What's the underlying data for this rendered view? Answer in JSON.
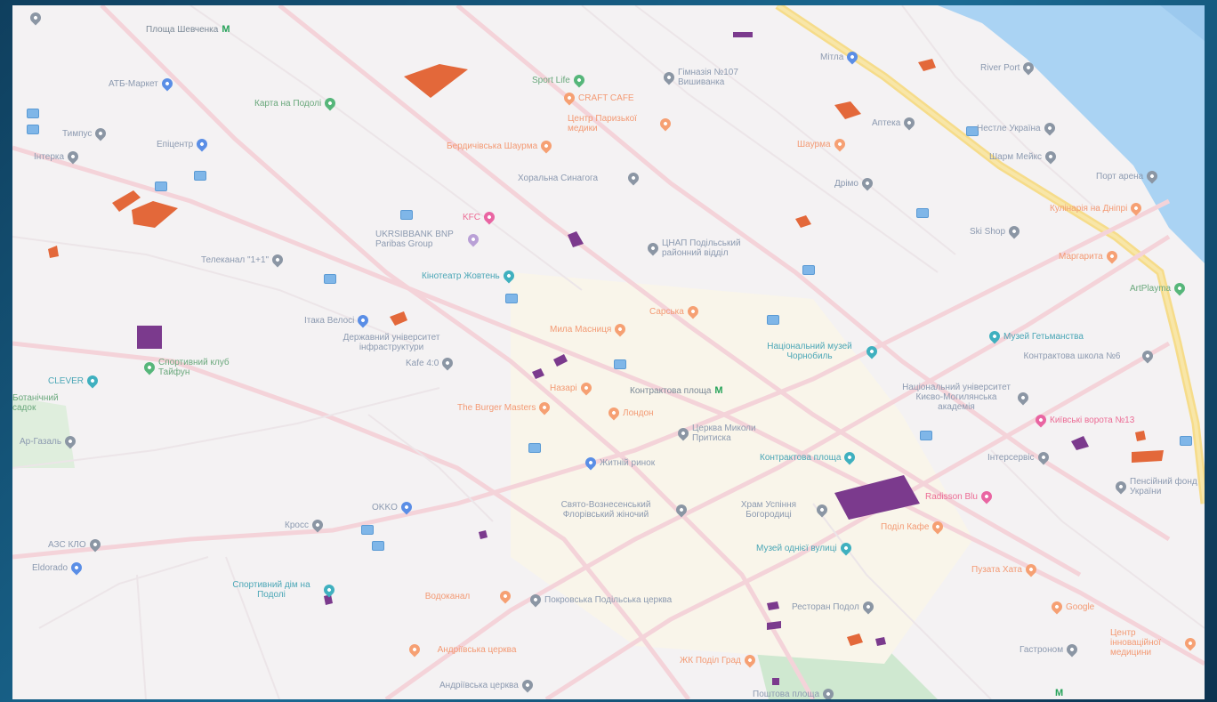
{
  "colors": {
    "water": "#aad3f3",
    "road_major": "#f6dc8a",
    "road_minor": "#f7d7dc",
    "park": "#cfe8d0",
    "building_orange": "#e3683a",
    "building_purple": "#7b3a8d",
    "pin_grey": "#8b96a4",
    "pin_blue": "#5a8ee6",
    "pin_orange": "#f6a073",
    "pin_green": "#56b67a",
    "pin_pink": "#e965a2",
    "pin_teal": "#3fb0bf"
  },
  "pois": [
    {
      "label": "",
      "icon": "grey-pin-icon",
      "kind": "shop",
      "color": "#8b96a4"
    },
    {
      "label": "Площа Шевченка",
      "icon": "metro-icon",
      "kind": "metro",
      "color": "#8b96a4"
    },
    {
      "label": "АТБ-Маркет",
      "icon": "shop-pin-icon",
      "kind": "shop",
      "color": "#5a8ee6"
    },
    {
      "label": "Карта на Подолі",
      "icon": "park-pin-icon",
      "kind": "park",
      "color": "#56b67a"
    },
    {
      "label": "Sport Life",
      "icon": "park-pin-icon",
      "kind": "park",
      "color": "#56b67a"
    },
    {
      "label": "CRAFT CAFE",
      "icon": "food-pin-icon",
      "kind": "food",
      "color": "#f6a073"
    },
    {
      "label": "Гімназія №107 Вишиванка",
      "icon": "grey-pin-icon",
      "kind": "shop",
      "color": "#8b96a4"
    },
    {
      "label": "Мітла",
      "icon": "shop-pin-icon",
      "kind": "shop",
      "color": "#5a8ee6"
    },
    {
      "label": "River Port",
      "icon": "grey-pin-icon",
      "kind": "shop",
      "color": "#8b96a4"
    },
    {
      "label": "Тимпус",
      "icon": "grey-pin-icon",
      "kind": "shop",
      "color": "#8b96a4"
    },
    {
      "label": "Епіцентр",
      "icon": "shop-pin-icon",
      "kind": "shop",
      "color": "#5a8ee6"
    },
    {
      "label": "Інтерка",
      "icon": "grey-pin-icon",
      "kind": "shop",
      "color": "#8b96a4"
    },
    {
      "label": "Центр Паризької медики",
      "icon": "food-pin-icon",
      "kind": "food",
      "color": "#f6a073"
    },
    {
      "label": "Бердичівська Шаурма",
      "icon": "food-pin-icon",
      "kind": "food",
      "color": "#f6a073"
    },
    {
      "label": "Хоральна Синагога",
      "icon": "grey-pin-icon",
      "kind": "shop",
      "color": "#8b96a4"
    },
    {
      "label": "Аптека",
      "icon": "grey-pin-icon",
      "kind": "shop",
      "color": "#8b96a4"
    },
    {
      "label": "Нестле Україна",
      "icon": "grey-pin-icon",
      "kind": "shop",
      "color": "#8b96a4"
    },
    {
      "label": "Шаурма",
      "icon": "food-pin-icon",
      "kind": "food",
      "color": "#f6a073"
    },
    {
      "label": "Шарм Мейкс",
      "icon": "grey-pin-icon",
      "kind": "shop",
      "color": "#8b96a4"
    },
    {
      "label": "Порт арена",
      "icon": "grey-pin-icon",
      "kind": "shop",
      "color": "#8b96a4"
    },
    {
      "label": "Дрімо",
      "icon": "grey-pin-icon",
      "kind": "shop",
      "color": "#8b96a4"
    },
    {
      "label": "KFC",
      "icon": "pink-pin-icon",
      "kind": "pink",
      "color": "#e965a2"
    },
    {
      "label": "UKRSIBBANK BNP Paribas Group",
      "icon": "bank-pin-icon",
      "kind": "shop",
      "color": "#b9a0d6"
    },
    {
      "label": "Телеканал \"1+1\"",
      "icon": "grey-pin-icon",
      "kind": "shop",
      "color": "#8b96a4"
    },
    {
      "label": "Кінотеатр Жовтень",
      "icon": "teal-pin-icon",
      "kind": "teal",
      "color": "#3fb0bf"
    },
    {
      "label": "ЦНАП Подільський районний відділ",
      "icon": "grey-pin-icon",
      "kind": "shop",
      "color": "#8b96a4"
    },
    {
      "label": "Кулінарія на Дніпрі",
      "icon": "food-pin-icon",
      "kind": "food",
      "color": "#f6a073"
    },
    {
      "label": "Ski Shop",
      "icon": "grey-pin-icon",
      "kind": "shop",
      "color": "#8b96a4"
    },
    {
      "label": "Маргарита",
      "icon": "food-pin-icon",
      "kind": "food",
      "color": "#f6a073"
    },
    {
      "label": "ArtPlayma",
      "icon": "park-pin-icon",
      "kind": "park",
      "color": "#56b67a"
    },
    {
      "label": "Сарська",
      "icon": "food-pin-icon",
      "kind": "food",
      "color": "#f6a073"
    },
    {
      "label": "Ітака Велосі",
      "icon": "shop-pin-icon",
      "kind": "shop",
      "color": "#5a8ee6"
    },
    {
      "label": "Державний університет інфраструктури",
      "icon": "grey-pin-icon",
      "kind": "shop",
      "color": "#8b96a4"
    },
    {
      "label": "Мила Масниця",
      "icon": "food-pin-icon",
      "kind": "food",
      "color": "#f6a073"
    },
    {
      "label": "Музей Гетьманства",
      "icon": "teal-pin-icon",
      "kind": "teal",
      "color": "#3fb0bf"
    },
    {
      "label": "Спортивний клуб Тайфун",
      "icon": "park-pin-icon",
      "kind": "park",
      "color": "#56b67a"
    },
    {
      "label": "Національний музей Чорнобиль",
      "icon": "teal-pin-icon",
      "kind": "teal",
      "color": "#3fb0bf"
    },
    {
      "label": "Контрактова школа №6",
      "icon": "grey-pin-icon",
      "kind": "shop",
      "color": "#8b96a4"
    },
    {
      "label": "Kafe 4:0",
      "icon": "grey-pin-icon",
      "kind": "shop",
      "color": "#8b96a4"
    },
    {
      "label": "CLEVER",
      "icon": "teal-pin-icon",
      "kind": "teal",
      "color": "#3fb0bf"
    },
    {
      "label": "Назарі",
      "icon": "food-pin-icon",
      "kind": "food",
      "color": "#f6a073"
    },
    {
      "label": "Контрактова площа",
      "icon": "metro-icon",
      "kind": "metro",
      "color": "#8b96a4"
    },
    {
      "label": "Національний університет Києво-Могилянська академія",
      "icon": "grey-pin-icon",
      "kind": "shop",
      "color": "#8b96a4"
    },
    {
      "label": "Ботанічний садок",
      "icon": "park-pin-icon",
      "kind": "park",
      "color": "#56b67a"
    },
    {
      "label": "The Burger Masters",
      "icon": "food-pin-icon",
      "kind": "food",
      "color": "#f6a073"
    },
    {
      "label": "Лондон",
      "icon": "food-pin-icon",
      "kind": "food",
      "color": "#f6a073"
    },
    {
      "label": "Церква Миколи Притиска",
      "icon": "grey-pin-icon",
      "kind": "shop",
      "color": "#8b96a4"
    },
    {
      "label": "Київські ворота №13",
      "icon": "pink-pin-icon",
      "kind": "pink",
      "color": "#e965a2"
    },
    {
      "label": "Ар-Газаль",
      "icon": "grey-pin-icon",
      "kind": "shop",
      "color": "#8b96a4"
    },
    {
      "label": "Житній ринок",
      "icon": "shop-pin-icon",
      "kind": "shop",
      "color": "#5a8ee6"
    },
    {
      "label": "Контрактова площа",
      "icon": "teal-pin-icon",
      "kind": "teal",
      "color": "#3fb0bf"
    },
    {
      "label": "Інтерсервіс",
      "icon": "grey-pin-icon",
      "kind": "shop",
      "color": "#8b96a4"
    },
    {
      "label": "Пенсійний фонд України",
      "icon": "grey-pin-icon",
      "kind": "shop",
      "color": "#8b96a4"
    },
    {
      "label": "Radisson Blu",
      "icon": "pink-pin-icon",
      "kind": "pink",
      "color": "#e965a2"
    },
    {
      "label": "OKKO",
      "icon": "shop-pin-icon",
      "kind": "shop",
      "color": "#5a8ee6"
    },
    {
      "label": "Свято-Вознесенський Флорівський жіночий",
      "icon": "grey-pin-icon",
      "kind": "shop",
      "color": "#8b96a4"
    },
    {
      "label": "Храм Успіння Богородиці",
      "icon": "grey-pin-icon",
      "kind": "shop",
      "color": "#8b96a4"
    },
    {
      "label": "Поділ Кафе",
      "icon": "food-pin-icon",
      "kind": "food",
      "color": "#f6a073"
    },
    {
      "label": "Кросс",
      "icon": "grey-pin-icon",
      "kind": "shop",
      "color": "#8b96a4"
    },
    {
      "label": "АЗС КЛО",
      "icon": "grey-pin-icon",
      "kind": "shop",
      "color": "#8b96a4"
    },
    {
      "label": "Музей однієї вулиці",
      "icon": "teal-pin-icon",
      "kind": "teal",
      "color": "#3fb0bf"
    },
    {
      "label": "Eldorado",
      "icon": "shop-pin-icon",
      "kind": "shop",
      "color": "#5a8ee6"
    },
    {
      "label": "Спортивний дім на Подолі",
      "icon": "teal-pin-icon",
      "kind": "teal",
      "color": "#3fb0bf"
    },
    {
      "label": "Пузата Хата",
      "icon": "food-pin-icon",
      "kind": "food",
      "color": "#f6a073"
    },
    {
      "label": "Водоканал",
      "icon": "grey-pin-icon",
      "kind": "shop",
      "color": "#8b96a4"
    },
    {
      "label": "Покровська Подільська церква",
      "icon": "grey-pin-icon",
      "kind": "shop",
      "color": "#8b96a4"
    },
    {
      "label": "Ресторан Подол",
      "icon": "food-pin-icon",
      "kind": "food",
      "color": "#f6a073"
    },
    {
      "label": "Google",
      "icon": "grey-pin-icon",
      "kind": "shop",
      "color": "#8b96a4"
    },
    {
      "label": "Гастроном",
      "icon": "food-pin-icon",
      "kind": "food",
      "color": "#f6a073"
    },
    {
      "label": "Центр інноваційної медицини",
      "icon": "food-pin-icon",
      "kind": "food",
      "color": "#f6a073"
    },
    {
      "label": "Андріївська церква",
      "icon": "food-pin-icon",
      "kind": "food",
      "color": "#f6a073"
    },
    {
      "label": "ЖК Поділ Град",
      "icon": "grey-pin-icon",
      "kind": "shop",
      "color": "#8b96a4"
    },
    {
      "label": "Андріївська церква",
      "icon": "grey-pin-icon",
      "kind": "shop",
      "color": "#8b96a4"
    },
    {
      "label": "Поштова площа",
      "icon": "metro-icon",
      "kind": "metro",
      "color": "#8b96a4"
    }
  ]
}
